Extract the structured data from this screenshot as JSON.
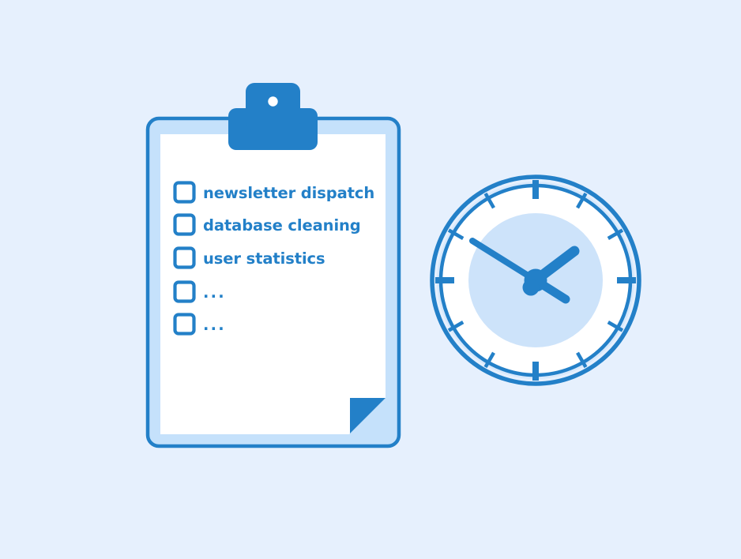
{
  "scene": {
    "title": "Task checklist and wall clock illustration",
    "background_color": "#e6f0fd"
  },
  "colors": {
    "background": "#e6f0fd",
    "accent_blue": "#2380c8",
    "light_blue": "#c5e1fb",
    "clock_face": "#cde3fa",
    "paper_white": "#ffffff"
  },
  "clipboard": {
    "name": "clipboard",
    "border_color": "#2380c8",
    "body_color": "#c5e1fb",
    "page_color": "#ffffff",
    "clip": {
      "name": "clipboard-clip",
      "color": "#2380c8",
      "hole_color": "#ffffff"
    },
    "page_fold": {
      "name": "page-corner-fold",
      "color": "#2380c8"
    },
    "checklist": {
      "checkbox_color": "#2380c8",
      "text_color": "#2380c8",
      "items": [
        {
          "label": "newsletter dispatch",
          "checked": false,
          "placeholder": false
        },
        {
          "label": "database cleaning",
          "checked": false,
          "placeholder": false
        },
        {
          "label": "user statistics",
          "checked": false,
          "placeholder": false
        },
        {
          "label": "...",
          "checked": false,
          "placeholder": true
        },
        {
          "label": "...",
          "checked": false,
          "placeholder": true
        }
      ]
    }
  },
  "clock": {
    "name": "wall-clock",
    "rim_color": "#2380c8",
    "rim_gap_color": "#d6e8fc",
    "tick_band_color": "#ffffff",
    "face_color": "#cde3fa",
    "hand_color": "#2380c8",
    "tick_count": 12,
    "major_ticks": [
      12,
      3,
      6,
      9
    ],
    "hands": {
      "hour": {
        "name": "hour-hand",
        "angle_deg": 52
      },
      "minute": {
        "name": "minute-hand",
        "angle_deg": 296
      },
      "counterweight": {
        "name": "hand-counterweight",
        "angle_deg": 116
      }
    }
  }
}
